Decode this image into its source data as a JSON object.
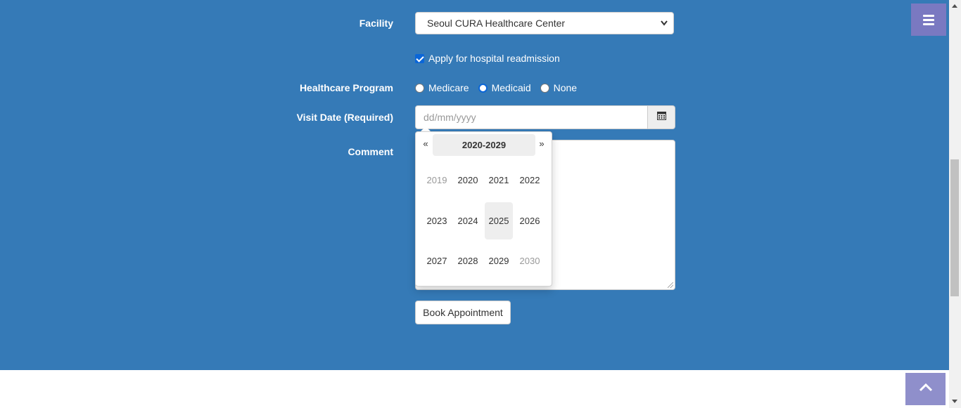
{
  "form": {
    "facility_label": "Facility",
    "facility_value": "Seoul CURA Healthcare Center",
    "readmission_label": "Apply for hospital readmission",
    "readmission_checked": true,
    "program_label": "Healthcare Program",
    "program_options": [
      "Medicare",
      "Medicaid",
      "None"
    ],
    "visit_date_label": "Visit Date (Required)",
    "visit_date_placeholder": "dd/mm/yyyy",
    "comment_label": "Comment",
    "book_button": "Book Appointment"
  },
  "datepicker": {
    "prev": "«",
    "next": "»",
    "range": "2020-2029",
    "years": [
      "2019",
      "2020",
      "2021",
      "2022",
      "2023",
      "2024",
      "2025",
      "2026",
      "2027",
      "2028",
      "2029",
      "2030"
    ],
    "highlighted_year": "2025"
  },
  "icons": {
    "menu": "hamburger-menu-icon",
    "calendar": "calendar-icon",
    "to_top": "chevron-up-icon"
  },
  "colors": {
    "hero_background": "#357ab7",
    "menu_button": "#7a79c1",
    "to_top_button": "#8f8fcb"
  }
}
